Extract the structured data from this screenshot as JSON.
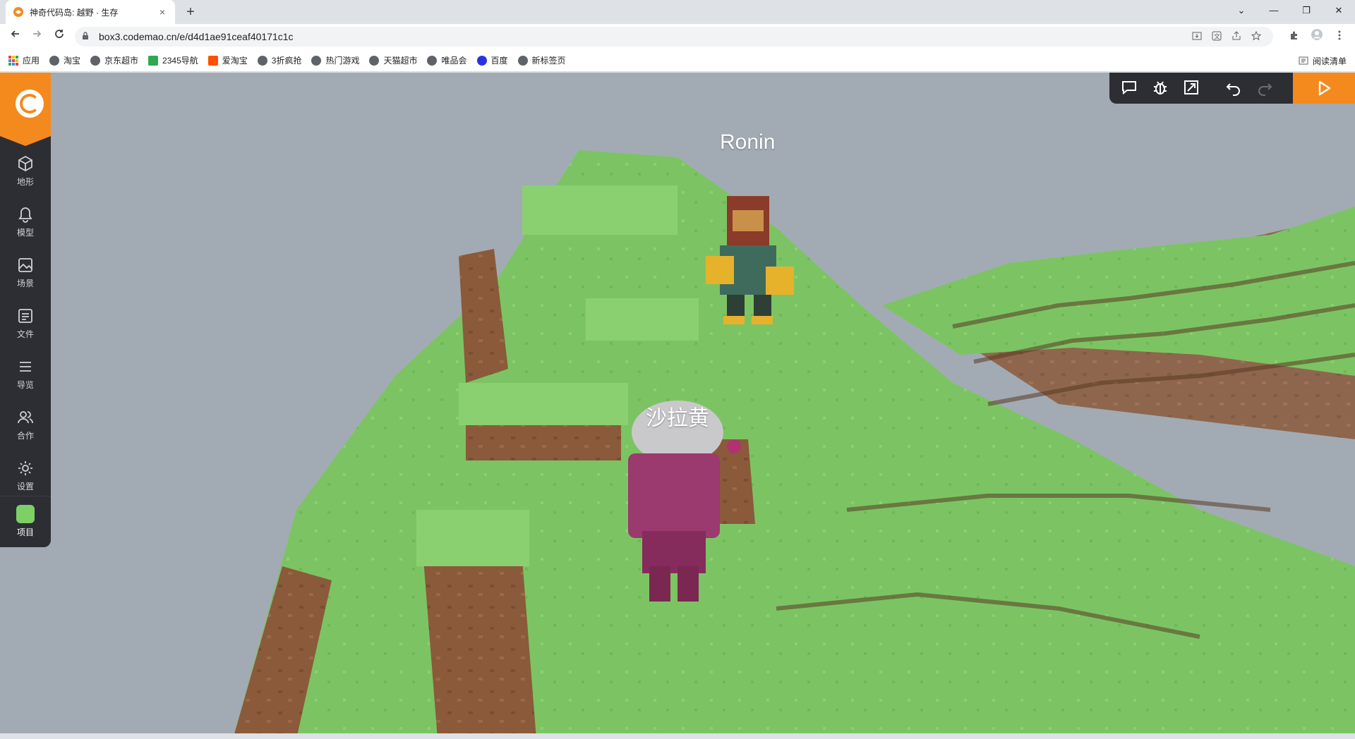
{
  "browser": {
    "tab_title": "神奇代码岛: 越野 · 生存",
    "tab_close": "×",
    "new_tab": "+",
    "url": "box3.codemao.cn/e/d4d1ae91ceaf40171c1c",
    "window_controls": [
      "⌄",
      "—",
      "❐",
      "✕"
    ]
  },
  "bookmarks": [
    {
      "label": "应用",
      "icon": "apps-icon"
    },
    {
      "label": "淘宝",
      "icon": "globe-icon"
    },
    {
      "label": "京东超市",
      "icon": "globe-icon"
    },
    {
      "label": "2345导航",
      "icon": "nav-icon"
    },
    {
      "label": "爱淘宝",
      "icon": "taobao-icon"
    },
    {
      "label": "3折疯抢",
      "icon": "globe-icon"
    },
    {
      "label": "热门游戏",
      "icon": "globe-icon"
    },
    {
      "label": "天猫超市",
      "icon": "globe-icon"
    },
    {
      "label": "唯品会",
      "icon": "globe-icon"
    },
    {
      "label": "百度",
      "icon": "baidu-icon"
    },
    {
      "label": "新标签页",
      "icon": "globe-icon"
    }
  ],
  "reading_list": "阅读清单",
  "sidebar": {
    "items": [
      {
        "label": "地形",
        "icon": "cube-icon"
      },
      {
        "label": "模型",
        "icon": "bell-icon"
      },
      {
        "label": "场景",
        "icon": "image-icon"
      },
      {
        "label": "文件",
        "icon": "file-icon"
      },
      {
        "label": "导览",
        "icon": "list-icon"
      },
      {
        "label": "合作",
        "icon": "users-icon"
      },
      {
        "label": "设置",
        "icon": "gear-icon"
      }
    ],
    "project_label": "项目"
  },
  "scene": {
    "player1_name": "Ronin",
    "player2_name": "沙拉黄"
  },
  "colors": {
    "accent": "#f48a1e",
    "sidebar_bg": "#2d2e33",
    "grass": "#7cc463",
    "dirt": "#8a5a3b",
    "sky": "#a2abb3"
  }
}
